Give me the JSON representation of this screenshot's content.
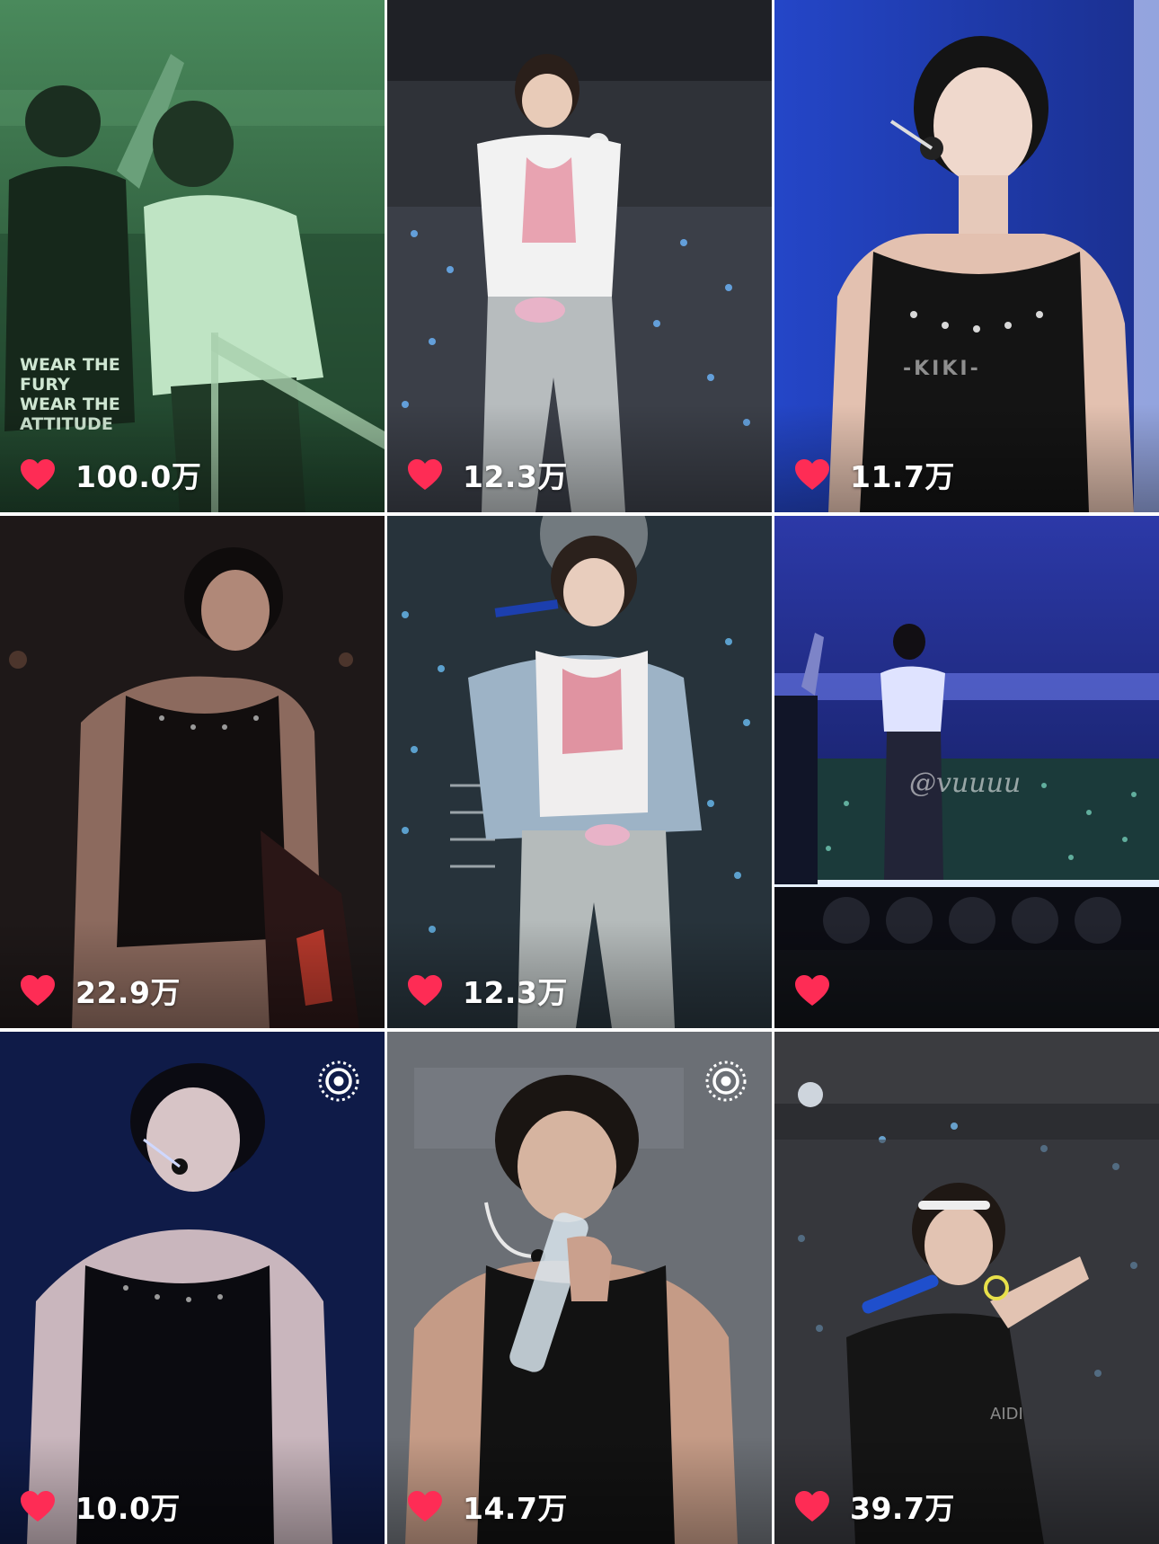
{
  "tiles": [
    {
      "likes": "100.0万",
      "scene": "green-tinted stage, two performers, one pointing up",
      "live": false,
      "bg": "#2c5f3c",
      "shirt_text": "WEAR THE FURY WEAR THE ATTITUDE"
    },
    {
      "likes": "12.3万",
      "scene": "performer in white tee and grey cargo pants on arena stage",
      "live": false,
      "bg": "#3a3d44"
    },
    {
      "likes": "11.7万",
      "scene": "performer with headset mic in black tank on blue stage",
      "live": false,
      "bg": "#1d3aa8",
      "shirt_text": "-KIKI-"
    },
    {
      "likes": "22.9万",
      "scene": "performer in black tank on dark stage",
      "live": false,
      "bg": "#1f1a1a"
    },
    {
      "likes": "12.3万",
      "scene": "performer singing into blue mic with light jacket",
      "live": false,
      "bg": "#2b3a44"
    },
    {
      "likes": "",
      "scene": "distant stage view with blue lights and crowd",
      "live": false,
      "bg": "#1d2360",
      "watermark": "@vuuuu"
    },
    {
      "likes": "10.0万",
      "scene": "performer with headset mic on deep blue background",
      "live": true,
      "bg": "#0f1c4a"
    },
    {
      "likes": "14.7万",
      "scene": "performer drinking from water bottle",
      "live": true,
      "bg": "#6a6e74"
    },
    {
      "likes": "39.7万",
      "scene": "performer pointing with mic in crowd",
      "live": false,
      "bg": "#2e2f33",
      "shirt_text": "AIDI"
    }
  ],
  "colors": {
    "heart": "#fe2c55",
    "count_text": "#ffffff"
  },
  "icons": {
    "like": "heart-icon",
    "live": "live-photo-icon"
  }
}
